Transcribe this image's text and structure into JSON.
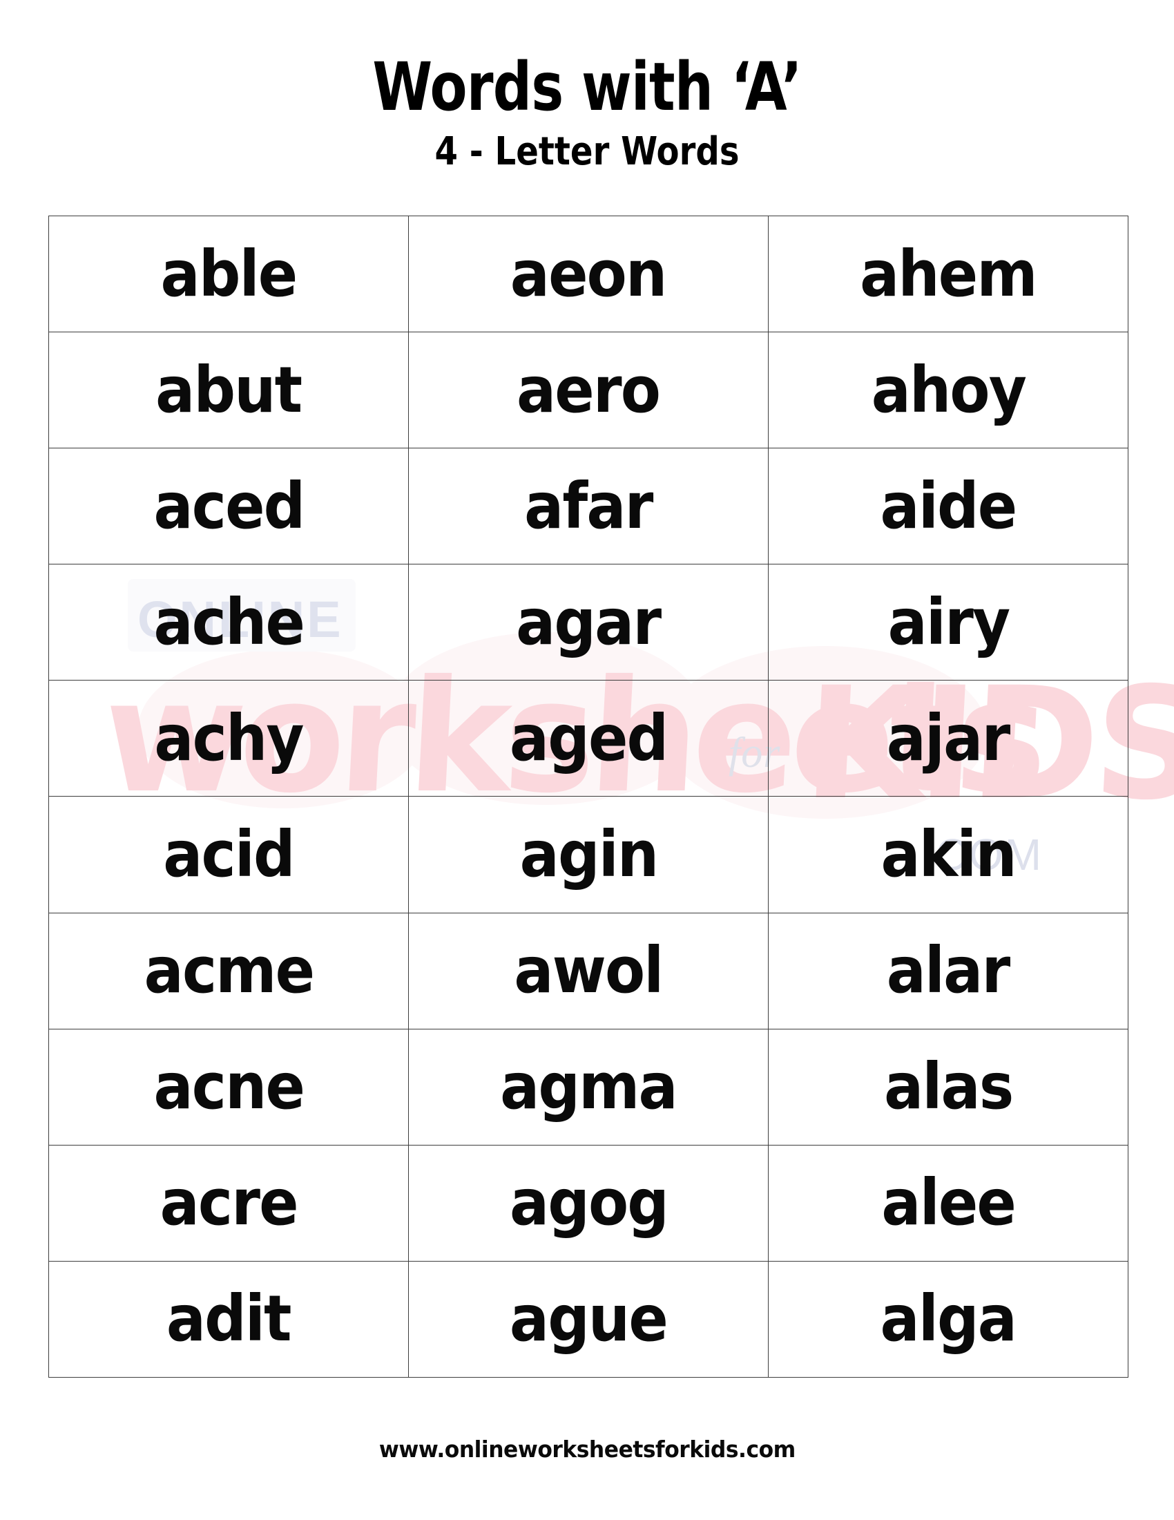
{
  "header": {
    "title": "Words with ‘A’",
    "subtitle": "4 - Letter Words"
  },
  "table": {
    "columns": 3,
    "rows": [
      [
        "able",
        "aeon",
        "ahem"
      ],
      [
        "abut",
        "aero",
        "ahoy"
      ],
      [
        "aced",
        "afar",
        "aide"
      ],
      [
        "ache",
        "agar",
        "airy"
      ],
      [
        "achy",
        "aged",
        "ajar"
      ],
      [
        "acid",
        "agin",
        "akin"
      ],
      [
        "acme",
        "awol",
        "alar"
      ],
      [
        "acne",
        "agma",
        "alas"
      ],
      [
        "acre",
        "agog",
        "alee"
      ],
      [
        "adit",
        "ague",
        "alga"
      ]
    ]
  },
  "watermark": {
    "script_text": "worksheets",
    "for_text": "for",
    "kids_text": "KIDS",
    "com_text": ".COM",
    "online_text": "ONLINE",
    "pink_color": "#fbd8dd",
    "gray_color": "#dfe2ee"
  },
  "footer": {
    "url": "www.onlineworksheetsforkids.com"
  },
  "colors": {
    "background": "#ffffff",
    "text": "#0a0a0a",
    "border": "#3d3d3d"
  }
}
